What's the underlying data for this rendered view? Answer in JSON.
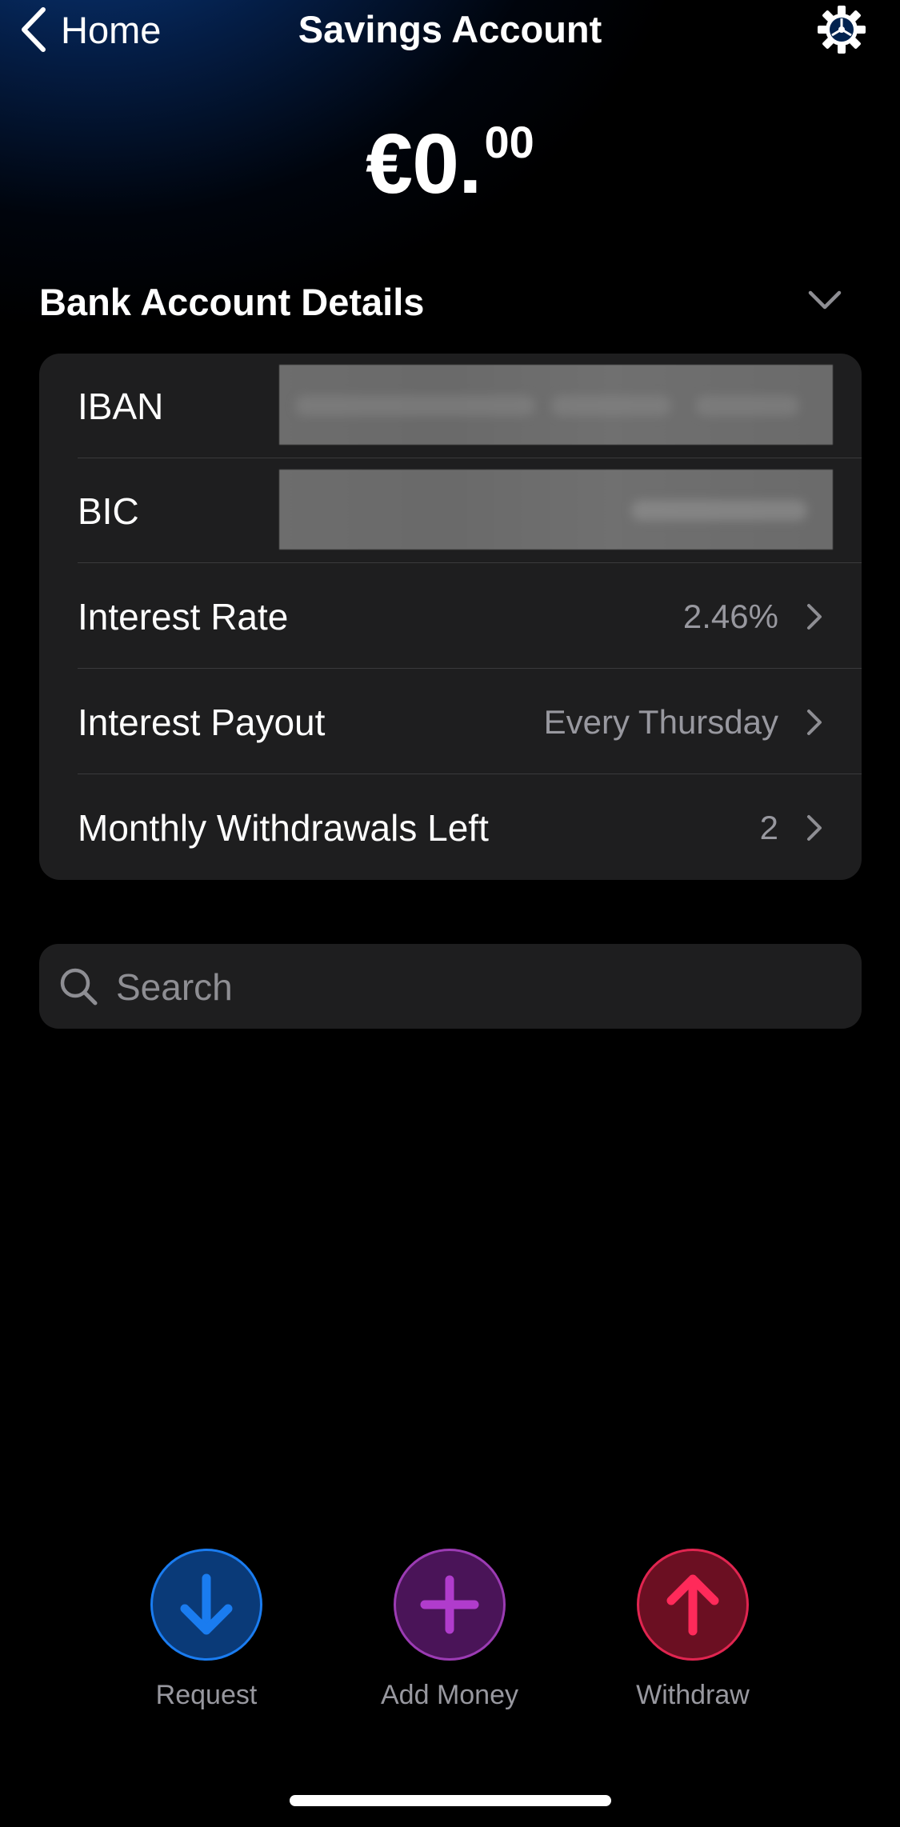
{
  "header": {
    "back_label": "Home",
    "title": "Savings Account",
    "settings_icon": "gear-icon"
  },
  "balance": {
    "main": "€0.",
    "cents": "00"
  },
  "details": {
    "section_title": "Bank Account Details",
    "rows": [
      {
        "label": "IBAN",
        "value": ""
      },
      {
        "label": "BIC",
        "value": ""
      },
      {
        "label": "Interest Rate",
        "value": "2.46%"
      },
      {
        "label": "Interest Payout",
        "value": "Every Thursday"
      },
      {
        "label": "Monthly Withdrawals Left",
        "value": "2"
      }
    ]
  },
  "search": {
    "placeholder": "Search"
  },
  "actions": [
    {
      "label": "Request",
      "icon": "arrow-down-icon",
      "color": "#1a7cf0"
    },
    {
      "label": "Add Money",
      "icon": "plus-icon",
      "color": "#b03ccc"
    },
    {
      "label": "Withdraw",
      "icon": "arrow-up-icon",
      "color": "#ff2a5a"
    }
  ]
}
